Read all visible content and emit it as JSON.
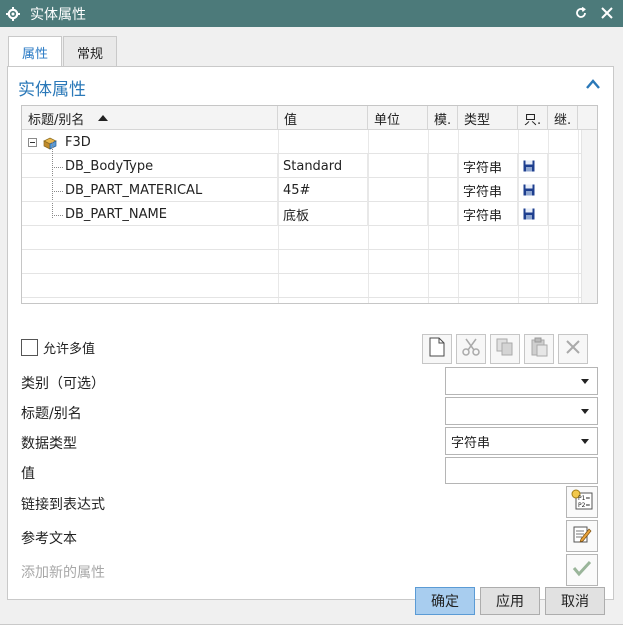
{
  "window": {
    "title": "实体属性"
  },
  "tabs": [
    {
      "label": "属性",
      "active": true
    },
    {
      "label": "常规",
      "active": false
    }
  ],
  "section": {
    "title": "实体属性"
  },
  "grid": {
    "columns": [
      "标题/别名",
      "值",
      "单位",
      "模.",
      "类型",
      "只.",
      "继."
    ],
    "root": {
      "label": "F3D"
    },
    "rows": [
      {
        "title": "DB_BodyType",
        "value": "Standard",
        "unit": "",
        "mode": "",
        "type": "字符串",
        "readonly_icon": "save-disk-icon"
      },
      {
        "title": "DB_PART_MATERICAL",
        "value": "45#",
        "unit": "",
        "mode": "",
        "type": "字符串",
        "readonly_icon": "save-disk-icon"
      },
      {
        "title": "DB_PART_NAME",
        "value": "底板",
        "unit": "",
        "mode": "",
        "type": "字符串",
        "readonly_icon": "save-disk-icon"
      }
    ]
  },
  "allow_multi": {
    "label": "允许多值",
    "checked": false
  },
  "toolbar": [
    "new-icon",
    "cut-icon",
    "copy-icon",
    "paste-icon",
    "delete-icon"
  ],
  "form": {
    "category_label": "类别（可选）",
    "category_value": "",
    "title_label": "标题/别名",
    "title_value": "",
    "datatype_label": "数据类型",
    "datatype_value": "字符串",
    "value_label": "值",
    "value_value": "",
    "link_label": "链接到表达式",
    "reftext_label": "参考文本",
    "add_label": "添加新的属性"
  },
  "footer": {
    "ok": "确定",
    "apply": "应用",
    "cancel": "取消"
  },
  "colors": {
    "titlebar": "#4c7a7a",
    "accent": "#2a78b8",
    "primary_button": "#a8cdef"
  }
}
